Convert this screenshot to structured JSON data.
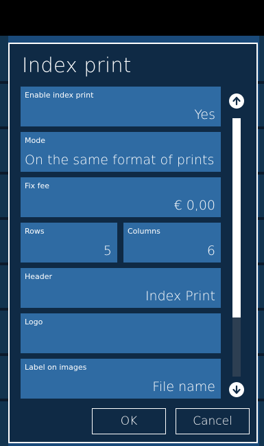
{
  "dialog": {
    "title": "Index print",
    "fields": {
      "enable": {
        "label": "Enable index print",
        "value": "Yes"
      },
      "mode": {
        "label": "Mode",
        "value": "On the same format of prints"
      },
      "fee": {
        "label": "Fix fee",
        "value": "€ 0,00"
      },
      "rows": {
        "label": "Rows",
        "value": "5"
      },
      "columns": {
        "label": "Columns",
        "value": "6"
      },
      "header": {
        "label": "Header",
        "value": "Index Print"
      },
      "logo": {
        "label": "Logo",
        "value": ""
      },
      "label_on_images": {
        "label": "Label on images",
        "value": "File name"
      }
    },
    "scroll": {
      "up_icon": "arrow-up-circle-icon",
      "down_icon": "arrow-down-circle-icon",
      "position_fraction": 0.77
    },
    "buttons": {
      "ok": "OK",
      "cancel": "Cancel"
    }
  },
  "colors": {
    "dialog_bg": "#0f2a45",
    "field_bg": "#2f6ba3",
    "page_bg": "#000000",
    "accent_text": "#ffffff"
  }
}
